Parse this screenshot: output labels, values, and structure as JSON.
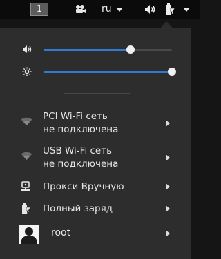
{
  "panel": {
    "workspace": "1",
    "keyboard_layout": "ru",
    "icons": [
      "camera-icon",
      "volume-icon",
      "battery-icon"
    ]
  },
  "menu": {
    "volume": {
      "icon": "volume-icon",
      "level": 0.68
    },
    "brightness": {
      "icon": "brightness-icon",
      "level": 1.0
    },
    "items": [
      {
        "icon": "wifi-icon",
        "title": "PCI Wi-Fi сеть",
        "subtitle": "не подключена"
      },
      {
        "icon": "wifi-icon",
        "title": "USB Wi-Fi сеть",
        "subtitle": "не подключена"
      },
      {
        "icon": "proxy-icon",
        "title": "Прокси Вручную"
      },
      {
        "icon": "battery-icon",
        "title": "Полный заряд"
      }
    ],
    "user": {
      "name": "root",
      "icon": "avatar-icon"
    }
  },
  "colors": {
    "accent": "#2f7ad6",
    "menu_bg": "#2d2d2d",
    "panel_bg": "#0b0b0b"
  }
}
